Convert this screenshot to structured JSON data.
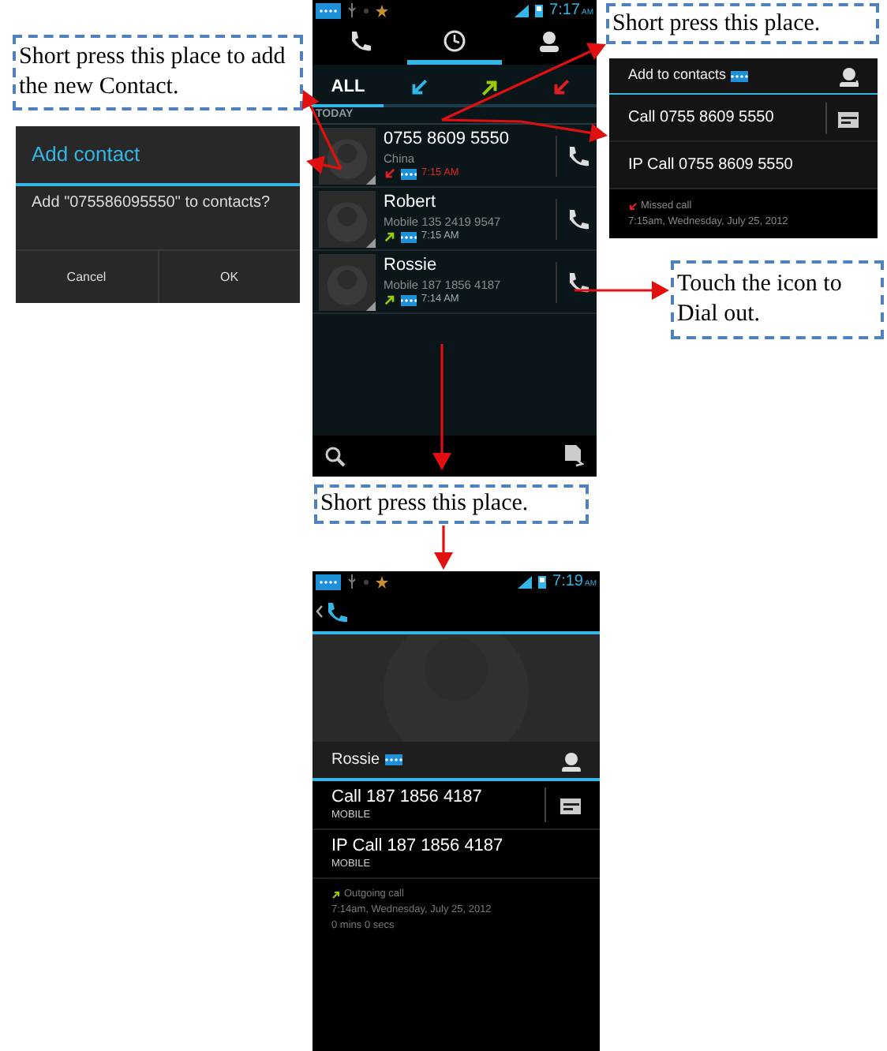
{
  "callouts": [
    {
      "text": "Short press this place to add the new Contact."
    },
    {
      "text": "Short press this place."
    },
    {
      "text": "Touch the icon to Dial out."
    },
    {
      "text": "Short press this place."
    }
  ],
  "call_log_screen": {
    "status_bar": {
      "time": "7:17",
      "meridiem": "AM"
    },
    "tabs": [
      {
        "kind": "phone",
        "selected": false
      },
      {
        "kind": "history",
        "selected": true
      },
      {
        "kind": "contacts",
        "selected": false
      }
    ],
    "filters": [
      {
        "kind": "all",
        "label": "ALL",
        "selected": true
      },
      {
        "kind": "incoming",
        "selected": false
      },
      {
        "kind": "outgoing",
        "selected": false
      },
      {
        "kind": "missed",
        "selected": false
      }
    ],
    "section": "TODAY",
    "calls": [
      {
        "name": "0755 8609 5550",
        "detail": "China",
        "kind": "missed",
        "time": "7:15 AM"
      },
      {
        "name": "Robert",
        "detail": "Mobile 135 2419 9547",
        "kind": "outgoing",
        "time": "7:15 AM"
      },
      {
        "name": "Rossie",
        "detail": "Mobile 187 1856 4187",
        "kind": "outgoing",
        "time": "7:14 AM"
      }
    ]
  },
  "add_contact_dialog": {
    "title": "Add contact",
    "message": "Add \"075586095550\" to contacts?",
    "buttons": [
      "Cancel",
      "OK"
    ]
  },
  "contact_popup": {
    "title": "Add to contacts",
    "actions": [
      "Call 0755 8609 5550",
      "IP Call 0755 8609 5550"
    ],
    "call": {
      "kind": "missed",
      "type": "Missed call",
      "timestamp": "7:15am, Wednesday, July 25, 2012"
    }
  },
  "contact_detail_screen": {
    "status_bar": {
      "time": "7:19",
      "meridiem": "AM"
    },
    "name": "Rossie",
    "actions": [
      {
        "label": "Call 187 1856 4187",
        "sublabel": "MOBILE"
      },
      {
        "label": "IP Call 187 1856 4187",
        "sublabel": "MOBILE"
      }
    ],
    "call": {
      "kind": "outgoing",
      "type": "Outgoing call",
      "timestamp": "7:14am, Wednesday, July 25, 2012",
      "duration": "0 mins 0 secs"
    }
  }
}
